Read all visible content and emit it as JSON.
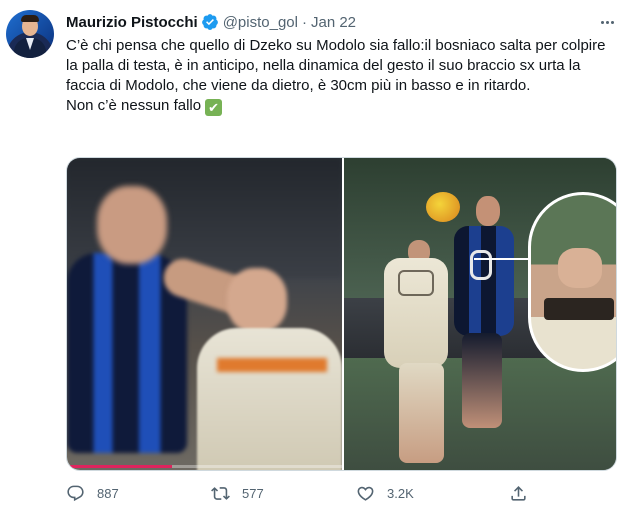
{
  "author": {
    "name": "Maurizio Pistocchi",
    "handle": "@pisto_gol",
    "separator": "·",
    "date": "Jan 22"
  },
  "tweet": {
    "text_line1": "C’è chi pensa che quello di Dzeko su Modolo sia fallo:il bosniaco salta per colpire la palla di testa, è in anticipo, nella dinamica del gesto il suo braccio sx urta la faccia di Modolo, che viene da dietro, è 30cm più in basso e in ritardo.",
    "text_line2": "Non c’è nessun fallo",
    "emoji": "✔"
  },
  "media": {
    "left_image": "video-frame",
    "right_image": "photo-with-zoom-inset",
    "video_progress": 0.38
  },
  "actions": {
    "reply_count": "887",
    "retweet_count": "577",
    "like_count": "3.2K"
  },
  "colors": {
    "verified": "#1d9bf0",
    "progress": "#e0245e",
    "icon": "#536471"
  }
}
